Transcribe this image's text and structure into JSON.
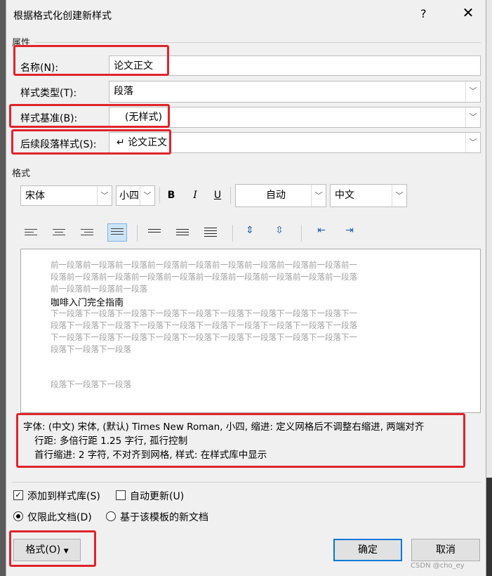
{
  "dialog": {
    "title": "根据格式化创建新样式",
    "help": "?",
    "close": "✕"
  },
  "properties": {
    "section_label": "属性",
    "name_label": "名称(N):",
    "name_value": "论文正文",
    "type_label": "样式类型(T):",
    "type_value": "段落",
    "based_label": "样式基准(B):",
    "based_value": "(无样式)",
    "next_label": "后续段落样式(S):",
    "next_value": "↵ 论文正文"
  },
  "format": {
    "section_label": "格式",
    "font": "宋体",
    "size": "小四",
    "bold": "B",
    "italic": "I",
    "underline": "U",
    "color": "自动",
    "script": "中文"
  },
  "preview": {
    "prev_lines": [
      "前一段落前一段落前一段落前一段落前一段落前一段落前一段落前一段落前一段落前一",
      "段落前一段落前一段落前一段落前一段落前一段落前一段落前一段落前一段落前一段落",
      "前一段落前一段落前一段落"
    ],
    "main": "咖啡入门完全指南",
    "next_lines": [
      "下一段落下一段落下一段落下一段落下一段落下一段落下一段落下一段落下一段落下一",
      "段落下一段落下一段落下一段落下一段落下一段落下一段落下一段落下一段落下一段落",
      "下一段落下一段落下一段落下一段落下一段落下一段落下一段落下一段落下一段落下一",
      "段落下一段落下一段落"
    ],
    "tail": "段落下一段落下一段落"
  },
  "description": {
    "line1": "字体: (中文) 宋体, (默认) Times New Roman, 小四, 缩进: 定义网格后不调整右缩进, 两端对齐",
    "line2": "行距: 多倍行距 1.25 字行, 孤行控制",
    "line3": "首行缩进:  2 字符, 不对齐到网格, 样式: 在样式库中显示"
  },
  "options": {
    "add_gallery": "添加到样式库(S)",
    "add_gallery_checked": true,
    "auto_update": "自动更新(U)",
    "auto_update_checked": false,
    "only_doc": "仅限此文档(D)",
    "template_doc": "基于该模板的新文档"
  },
  "buttons": {
    "format": "格式(O)",
    "ok": "确定",
    "cancel": "取消"
  },
  "watermark": "CSDN @cho_ey",
  "colors": {
    "highlight_red": "#e0242c",
    "ok_border": "#0078d7"
  }
}
